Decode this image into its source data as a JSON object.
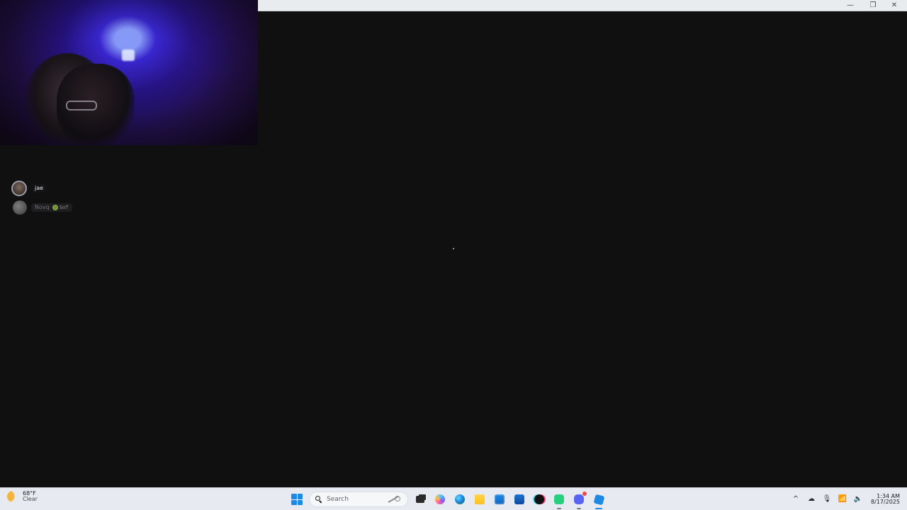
{
  "voice_users": [
    {
      "name": "jae",
      "active": true
    },
    {
      "name": "Novq",
      "active": false,
      "tag": "SoT"
    }
  ],
  "taskbar": {
    "weather": {
      "temp": "68°F",
      "condition": "Clear",
      "icon": "moon-icon"
    },
    "search": {
      "placeholder": "Search"
    },
    "apps": [
      {
        "name": "task-view",
        "icon": "taskview-icon"
      },
      {
        "name": "copilot",
        "icon": "copilot-icon"
      },
      {
        "name": "edge",
        "icon": "edge-icon"
      },
      {
        "name": "file-explorer",
        "icon": "files-icon"
      },
      {
        "name": "microsoft-store",
        "icon": "store-icon"
      },
      {
        "name": "outlook",
        "icon": "outlook-icon"
      },
      {
        "name": "tiktok",
        "icon": "tiktok-icon"
      },
      {
        "name": "chat-app",
        "icon": "chat-icon"
      },
      {
        "name": "discord",
        "icon": "discord-icon"
      },
      {
        "name": "roblox",
        "icon": "roblox-icon"
      }
    ],
    "clock": {
      "time": "1:34 AM",
      "date": "8/17/2025"
    }
  },
  "colors": {
    "desktop_bg": "#101011",
    "taskbar_bg": "#e7ebf1",
    "accent_blue": "#1e88e5",
    "discord": "#5865f2",
    "chat_green": "#26d07c"
  }
}
